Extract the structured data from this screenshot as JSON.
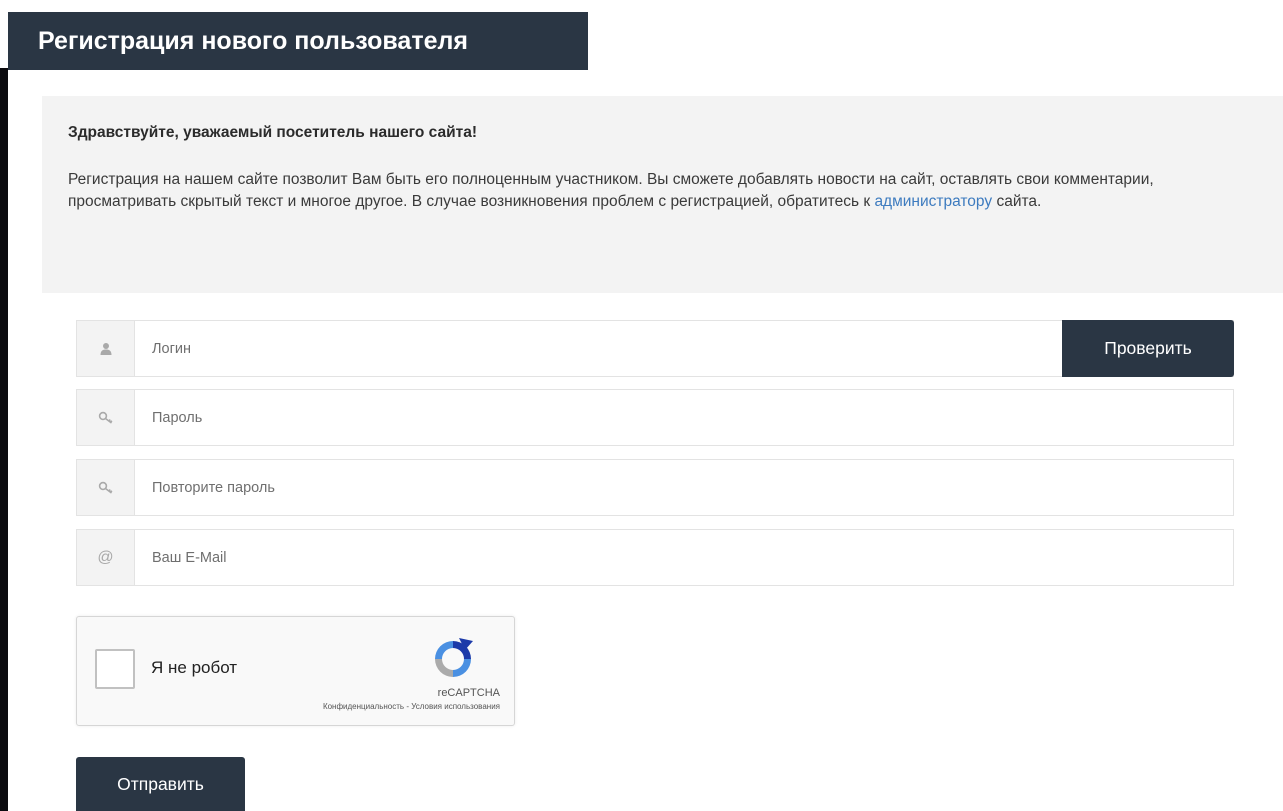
{
  "header": {
    "title": "Регистрация нового пользователя"
  },
  "intro": {
    "greeting": "Здравствуйте, уважаемый посетитель нашего сайта!",
    "text_before_link": "Регистрация на нашем сайте позволит Вам быть его полноценным участником. Вы сможете добавлять новости на сайт, оставлять свои комментарии, просматривать скрытый текст и многое другое. В случае возникновения проблем с регистрацией, обратитесь к ",
    "link_text": "администратору",
    "text_after_link": " сайта."
  },
  "form": {
    "login": {
      "icon": "user-icon",
      "placeholder": "Логин",
      "value": "",
      "check_label": "Проверить"
    },
    "password": {
      "icon": "key-icon",
      "placeholder": "Пароль",
      "value": ""
    },
    "password_repeat": {
      "icon": "key-icon",
      "placeholder": "Повторите пароль",
      "value": ""
    },
    "email": {
      "icon": "at-icon",
      "placeholder": "Ваш E-Mail",
      "value": ""
    },
    "submit_label": "Отправить"
  },
  "captcha": {
    "label": "Я не робот",
    "brand": "reCAPTCHA",
    "privacy": "Конфиденциальность",
    "separator": " - ",
    "terms": "Условия использования",
    "checked": false
  },
  "colors": {
    "accent": "#2a3644",
    "link": "#3d7bbf",
    "panel": "#f3f3f3"
  }
}
